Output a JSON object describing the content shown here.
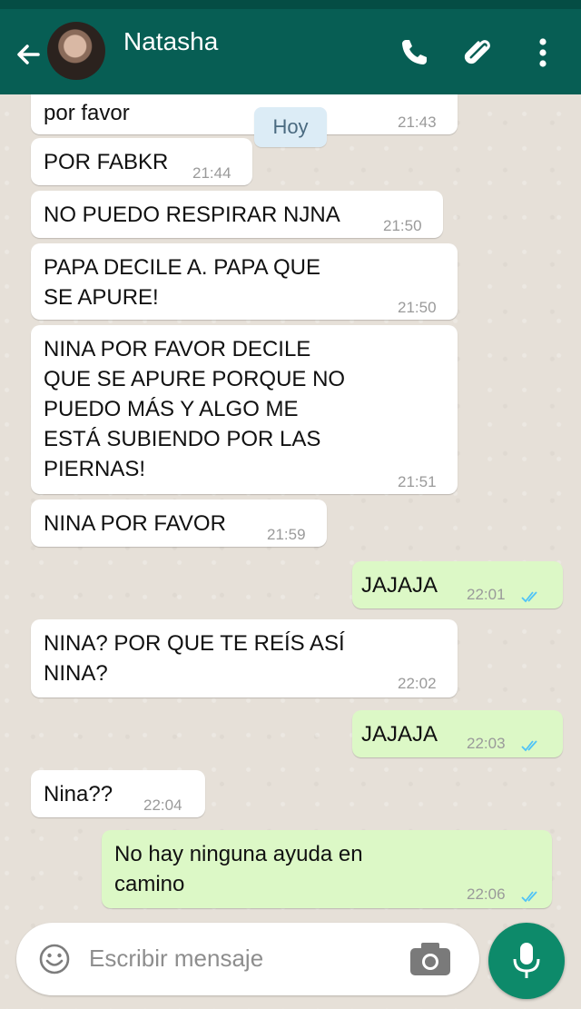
{
  "header": {
    "contact_name": "Natasha",
    "icons": [
      "back-arrow-icon",
      "phone-icon",
      "paperclip-icon",
      "more-vert-icon"
    ]
  },
  "date_badge": "Hoy",
  "messages": [
    {
      "direction": "in",
      "text": "por favor",
      "time": "21:43"
    },
    {
      "direction": "in",
      "text": "POR FABKR",
      "time": "21:44"
    },
    {
      "direction": "in",
      "text": "NO PUEDO RESPIRAR NJNA",
      "time": "21:50"
    },
    {
      "direction": "in",
      "text": "PAPA DECILE A. PAPA QUE\nSE APURE!",
      "time": "21:50"
    },
    {
      "direction": "in",
      "text": "NINA POR FAVOR DECILE\nQUE SE APURE PORQUE NO\nPUEDO MÁS Y ALGO ME\nESTÁ SUBIENDO POR LAS\nPIERNAS!",
      "time": "21:51"
    },
    {
      "direction": "in",
      "text": "NINA POR FAVOR",
      "time": "21:59"
    },
    {
      "direction": "out",
      "text": "JAJAJA",
      "time": "22:01"
    },
    {
      "direction": "in",
      "text": "NINA? POR QUE TE REÍS ASÍ\nNINA?",
      "time": "22:02"
    },
    {
      "direction": "out",
      "text": "JAJAJA",
      "time": "22:03"
    },
    {
      "direction": "in",
      "text": "Nina??",
      "time": "22:04"
    },
    {
      "direction": "out",
      "text": "No hay ninguna ayuda en\ncamino",
      "time": "22:06"
    }
  ],
  "composer": {
    "placeholder": "Escribir mensaje",
    "icons": [
      "emoji-icon",
      "camera-icon",
      "mic-icon"
    ]
  },
  "colors": {
    "header": "#075e54",
    "outgoing_bubble": "#dcf8c6",
    "incoming_bubble": "#ffffff",
    "read_ticks": "#4fc3f7",
    "mic_button": "#0d8a6a"
  }
}
